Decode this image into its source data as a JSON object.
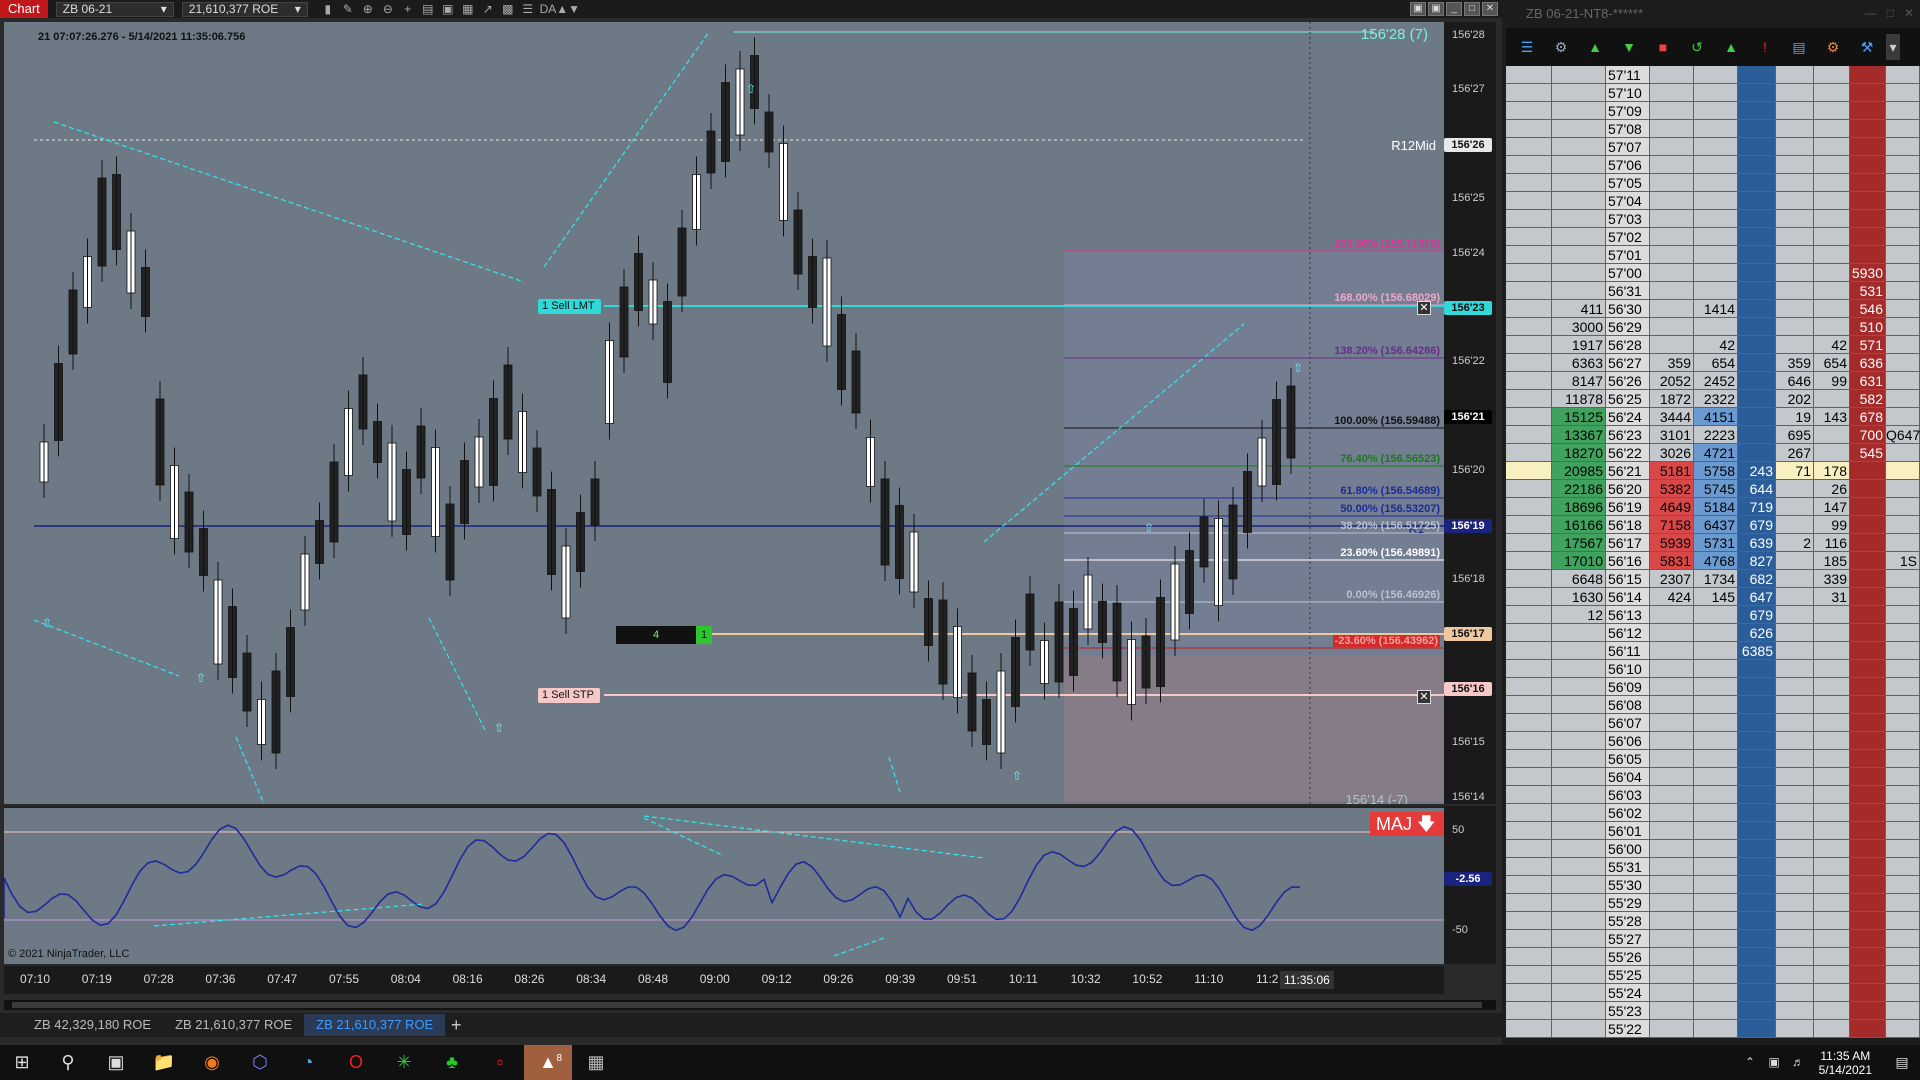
{
  "toolbar": {
    "title": "Chart",
    "instrument": "ZB 06-21",
    "account": "21,610,377 ROE",
    "extra": "DA▲▼"
  },
  "chart": {
    "timestamp": "21 07:07:26.276 - 5/14/2021 11:35:06.756",
    "copyright": "© 2021 NinjaTrader, LLC",
    "top_price_label": "156'28 (7)",
    "r12mid_label": "R12Mid",
    "r1_label": "R1",
    "bottom_price_label": "156'14 (-7)",
    "maj_label": "MAJ",
    "sell_lmt": {
      "qty": "1",
      "text": "Sell LMT"
    },
    "sell_stp": {
      "qty": "1",
      "text": "Sell STP"
    },
    "position": {
      "qty": "4",
      "pnl": "1"
    },
    "fib_levels": [
      {
        "label": "200.00% (156.71970)",
        "color": "#e0309a"
      },
      {
        "label": "168.00% (156.68029)",
        "color": "#f0a8c8"
      },
      {
        "label": "138.20% (156.64286)",
        "color": "#6a2a8a"
      },
      {
        "label": "100.00% (156.59488)",
        "color": "#111111"
      },
      {
        "label": "76.40% (156.56523)",
        "color": "#1a7a1a"
      },
      {
        "label": "61.80% (156.54689)",
        "color": "#1a2a9a"
      },
      {
        "label": "50.00% (156.53207)",
        "color": "#1a2a9a"
      },
      {
        "label": "38.20% (156.51725)",
        "color": "#b8c4d0"
      },
      {
        "label": "23.60% (156.49891)",
        "color": "#ffffff"
      },
      {
        "label": "0.00% (156.46926)",
        "color": "#b8c4d0"
      },
      {
        "label": "-23.60% (156.43962)",
        "color": "#c01818"
      }
    ],
    "price_ticks": [
      "156'28",
      "156'27",
      "156'26",
      "156'25",
      "156'24",
      "156'23",
      "156'22",
      "156'21",
      "156'20",
      "156'19",
      "156'18",
      "156'17",
      "156'16",
      "156'15",
      "156'14"
    ],
    "price_boxes": [
      {
        "label": "156'26",
        "color": "#e8e8e8"
      },
      {
        "label": "156'23",
        "color": "#30d8d8"
      },
      {
        "label": "156'21",
        "color": "#000000"
      },
      {
        "label": "156'19",
        "color": "#1a237e"
      },
      {
        "label": "156'17",
        "color": "#f0c8a0"
      },
      {
        "label": "156'16",
        "color": "#f6c8c8"
      }
    ],
    "ind_ticks": [
      "50",
      "-50"
    ],
    "ind_value": "-2.56",
    "time_ticks": [
      "07:10",
      "07:19",
      "07:28",
      "07:36",
      "07:47",
      "07:55",
      "08:04",
      "08:16",
      "08:26",
      "08:34",
      "08:48",
      "09:00",
      "09:12",
      "09:26",
      "09:39",
      "09:51",
      "10:11",
      "10:32",
      "10:52",
      "11:10",
      "11:2"
    ],
    "cursor_time": "11:35:06"
  },
  "tabs": [
    {
      "label": "ZB 42,329,180 ROE"
    },
    {
      "label": "ZB 21,610,377 ROE"
    },
    {
      "label": "ZB 21,610,377 ROE"
    }
  ],
  "dom": {
    "title": "ZB 06-21-NT8-******",
    "rows": [
      {
        "p": "57'11"
      },
      {
        "p": "57'10"
      },
      {
        "p": "57'09"
      },
      {
        "p": "57'08"
      },
      {
        "p": "57'07"
      },
      {
        "p": "57'06"
      },
      {
        "p": "57'05"
      },
      {
        "p": "57'04"
      },
      {
        "p": "57'03"
      },
      {
        "p": "57'02"
      },
      {
        "p": "57'01"
      },
      {
        "p": "57'00",
        "ask": "5930"
      },
      {
        "p": "56'31",
        "ask": "531"
      },
      {
        "p": "56'30",
        "vol": "411",
        "sa": "1414",
        "ask": "546"
      },
      {
        "p": "56'29",
        "vol": "3000",
        "ask": "510"
      },
      {
        "p": "56'28",
        "vol": "1917",
        "sa": "42",
        "as": "42",
        "ask": "571"
      },
      {
        "p": "56'27",
        "vol": "6363",
        "sb": "359",
        "sa": "654",
        "bs": "359",
        "as": "654",
        "ask": "636"
      },
      {
        "p": "56'26",
        "vol": "8147",
        "sb": "2052",
        "sa": "2452",
        "bs": "646",
        "as": "99",
        "ask": "631"
      },
      {
        "p": "56'25",
        "vol": "11878",
        "sb": "1872",
        "sa": "2322",
        "bs": "202",
        "ask": "582"
      },
      {
        "p": "56'24",
        "vol": "15125",
        "sb": "3444",
        "sa": "4151",
        "bs": "19",
        "as": "143",
        "ask": "678"
      },
      {
        "p": "56'23",
        "vol": "13367",
        "sb": "3101",
        "sa": "2223",
        "bs": "695",
        "ask": "700",
        "ext": "Q647"
      },
      {
        "p": "56'22",
        "vol": "18270",
        "sb": "3026",
        "sa": "4721",
        "bs": "267",
        "ask": "545"
      },
      {
        "p": "56'21",
        "vol": "20985",
        "sb": "5181",
        "sa": "5758",
        "bid": "243",
        "bs": "71",
        "as": "178"
      },
      {
        "p": "56'20",
        "vol": "22186",
        "sb": "5382",
        "sa": "5745",
        "bid": "644",
        "as": "26"
      },
      {
        "p": "56'19",
        "vol": "18696",
        "sb": "4649",
        "sa": "5184",
        "bid": "719",
        "as": "147"
      },
      {
        "p": "56'18",
        "vol": "16166",
        "sb": "7158",
        "sa": "6437",
        "bid": "679",
        "as": "99"
      },
      {
        "p": "56'17",
        "vol": "17567",
        "sb": "5939",
        "sa": "5731",
        "bid": "639",
        "bs": "2",
        "as": "116"
      },
      {
        "p": "56'16",
        "vol": "17010",
        "sb": "5831",
        "sa": "4768",
        "bid": "827",
        "as": "185",
        "ext": "1S"
      },
      {
        "p": "56'15",
        "vol": "6648",
        "sb": "2307",
        "sa": "1734",
        "bid": "682",
        "as": "339"
      },
      {
        "p": "56'14",
        "vol": "1630",
        "sb": "424",
        "sa": "145",
        "bid": "647",
        "as": "31"
      },
      {
        "p": "56'13",
        "vol": "12",
        "bid": "679"
      },
      {
        "p": "56'12",
        "bid": "626"
      },
      {
        "p": "56'11",
        "bid": "6385"
      },
      {
        "p": "56'10"
      },
      {
        "p": "56'09"
      },
      {
        "p": "56'08"
      },
      {
        "p": "56'07"
      },
      {
        "p": "56'06"
      },
      {
        "p": "56'05"
      },
      {
        "p": "56'04"
      },
      {
        "p": "56'03"
      },
      {
        "p": "56'02"
      },
      {
        "p": "56'01"
      },
      {
        "p": "56'00"
      },
      {
        "p": "55'31"
      },
      {
        "p": "55'30"
      },
      {
        "p": "55'29"
      },
      {
        "p": "55'28"
      },
      {
        "p": "55'27"
      },
      {
        "p": "55'26"
      },
      {
        "p": "55'25"
      },
      {
        "p": "55'24"
      },
      {
        "p": "55'23"
      },
      {
        "p": "55'22"
      }
    ]
  },
  "taskbar": {
    "time": "11:35 AM",
    "date": "5/14/2021",
    "badge": "8"
  }
}
